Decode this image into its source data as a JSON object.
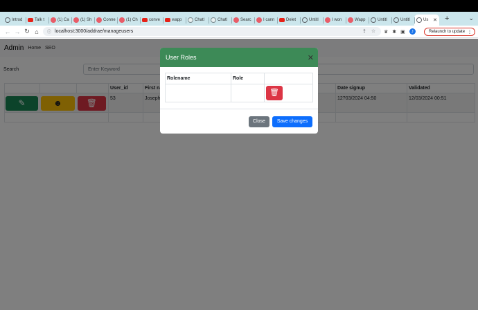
{
  "browser": {
    "tabs": [
      {
        "label": "Introd",
        "icon": "globe-icon"
      },
      {
        "label": "Talk t",
        "icon": "youtube-icon"
      },
      {
        "label": "(1) Ca",
        "icon": "app-icon"
      },
      {
        "label": "(1) Sh",
        "icon": "app-icon"
      },
      {
        "label": "Conne",
        "icon": "app-icon"
      },
      {
        "label": "(1) Ch",
        "icon": "app-icon"
      },
      {
        "label": "conve",
        "icon": "youtube-icon"
      },
      {
        "label": "wapp",
        "icon": "youtube-icon"
      },
      {
        "label": "Chatl",
        "icon": "chatgpt-icon"
      },
      {
        "label": "Chatl",
        "icon": "chatgpt-icon"
      },
      {
        "label": "Searc",
        "icon": "app-icon"
      },
      {
        "label": "I cann",
        "icon": "app-icon"
      },
      {
        "label": "Delet",
        "icon": "youtube-icon"
      },
      {
        "label": "Untitl",
        "icon": "globe-icon"
      },
      {
        "label": "I won",
        "icon": "app-icon"
      },
      {
        "label": "Wapp",
        "icon": "app-icon"
      },
      {
        "label": "Untitl",
        "icon": "globe-icon"
      },
      {
        "label": "Untitl",
        "icon": "globe-icon"
      },
      {
        "label": "Us",
        "icon": "globe-icon",
        "active": true
      }
    ],
    "url": "localhost:3000/addrae/manageusers",
    "profile_initial": "J",
    "relaunch_label": "Relaunch to update"
  },
  "app": {
    "brand": "Admin",
    "nav": [
      "Home",
      "SEO"
    ],
    "search_label": "Search",
    "search_placeholder": "Enter Keyword",
    "table": {
      "headers": [
        "",
        "",
        "",
        "User_id",
        "First na",
        "",
        "",
        "Date signup",
        "Validated"
      ],
      "rows": [
        {
          "user_id": "53",
          "first_name": "Joseph",
          "date_signup": "12?03/2024 04:50",
          "validated": "12/03/2024 00:51"
        }
      ]
    }
  },
  "modal": {
    "title": "User Roles",
    "headers": [
      "Rolename",
      "Role",
      ""
    ],
    "close_label": "Close",
    "save_label": "Save changes"
  },
  "colors": {
    "modal_header": "#3d8a57",
    "primary": "#0d6efd",
    "danger": "#dc3545",
    "success": "#198754",
    "warning": "#ffc107",
    "secondary": "#6c757d"
  }
}
